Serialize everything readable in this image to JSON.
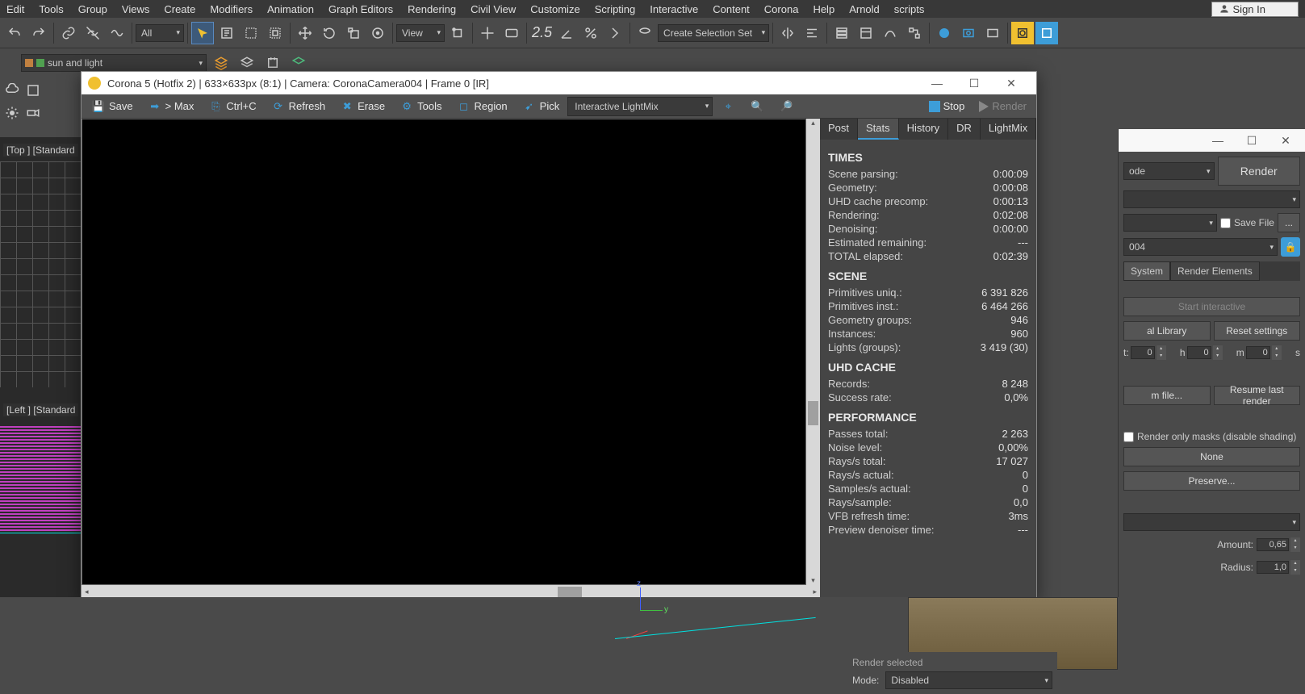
{
  "menu": [
    "Edit",
    "Tools",
    "Group",
    "Views",
    "Create",
    "Modifiers",
    "Animation",
    "Graph Editors",
    "Rendering",
    "Civil View",
    "Customize",
    "Scripting",
    "Interactive",
    "Content",
    "Corona",
    "Help",
    "Arnold",
    "scripts"
  ],
  "signin": "Sign In",
  "toolbar": {
    "filter_dd": "All",
    "view_dd": "View",
    "selset_dd": "Create Selection Set",
    "transform_num": "2.5"
  },
  "toolbar2": {
    "layer_name": "sun and light"
  },
  "viewport": {
    "top_label": "[Top ] [Standard",
    "left_label": "[Left ] [Standard"
  },
  "vfb": {
    "title": "Corona 5 (Hotfix 2) | 633×633px (8:1) | Camera: CoronaCamera004 | Frame 0 [IR]",
    "buttons": {
      "save": "Save",
      "max": "> Max",
      "ctrlc": "Ctrl+C",
      "refresh": "Refresh",
      "erase": "Erase",
      "tools": "Tools",
      "region": "Region",
      "pick": "Pick",
      "lightmix_dd": "Interactive LightMix",
      "stop": "Stop",
      "render": "Render"
    },
    "tabs": [
      "Post",
      "Stats",
      "History",
      "DR",
      "LightMix"
    ],
    "active_tab": "Stats",
    "stats": {
      "times_header": "TIMES",
      "times": [
        {
          "label": "Scene parsing:",
          "value": "0:00:09"
        },
        {
          "label": "Geometry:",
          "value": "0:00:08"
        },
        {
          "label": "UHD cache precomp:",
          "value": "0:00:13"
        },
        {
          "label": "Rendering:",
          "value": "0:02:08"
        },
        {
          "label": "Denoising:",
          "value": "0:00:00"
        },
        {
          "label": "Estimated remaining:",
          "value": "---"
        },
        {
          "label": "TOTAL elapsed:",
          "value": "0:02:39"
        }
      ],
      "scene_header": "SCENE",
      "scene": [
        {
          "label": "Primitives uniq.:",
          "value": "6 391 826"
        },
        {
          "label": "Primitives inst.:",
          "value": "6 464 266"
        },
        {
          "label": "Geometry groups:",
          "value": "946"
        },
        {
          "label": "Instances:",
          "value": "960"
        },
        {
          "label": "Lights (groups):",
          "value": "3 419 (30)"
        }
      ],
      "uhd_header": "UHD CACHE",
      "uhd": [
        {
          "label": "Records:",
          "value": "8 248"
        },
        {
          "label": "Success rate:",
          "value": "0,0%"
        }
      ],
      "perf_header": "PERFORMANCE",
      "perf": [
        {
          "label": "Passes total:",
          "value": "2 263"
        },
        {
          "label": "Noise level:",
          "value": "0,00%"
        },
        {
          "label": "Rays/s total:",
          "value": "17 027"
        },
        {
          "label": "Rays/s actual:",
          "value": "0"
        },
        {
          "label": "Samples/s actual:",
          "value": "0"
        },
        {
          "label": "Rays/sample:",
          "value": "0,0"
        },
        {
          "label": "VFB refresh time:",
          "value": "3ms"
        },
        {
          "label": "Preview denoiser time:",
          "value": "---"
        }
      ]
    }
  },
  "right_panel": {
    "mode_dd": "ode",
    "render_btn": "Render",
    "save_file": "Save File",
    "save_dots": "...",
    "preset_dd": "004",
    "tabs": [
      "System",
      "Render Elements"
    ],
    "start_interactive": "Start interactive",
    "al_library": "al Library",
    "reset_settings": "Reset settings",
    "time_limit_suffix": "t:",
    "h_val": "0",
    "h_unit": "h",
    "m_val": "0",
    "m_unit": "m",
    "s_val": "0",
    "s_unit": "s",
    "from_file": "m file...",
    "resume": "Resume last render",
    "render_masks": "Render only masks (disable shading)",
    "none": "None",
    "preserve": "Preserve...",
    "amount_label": "Amount:",
    "amount_val": "0,65",
    "radius_label": "Radius:",
    "radius_val": "1,0"
  },
  "bottom": {
    "render_selected": "Render selected",
    "mode_label": "Mode:",
    "mode_dd": "Disabled"
  }
}
